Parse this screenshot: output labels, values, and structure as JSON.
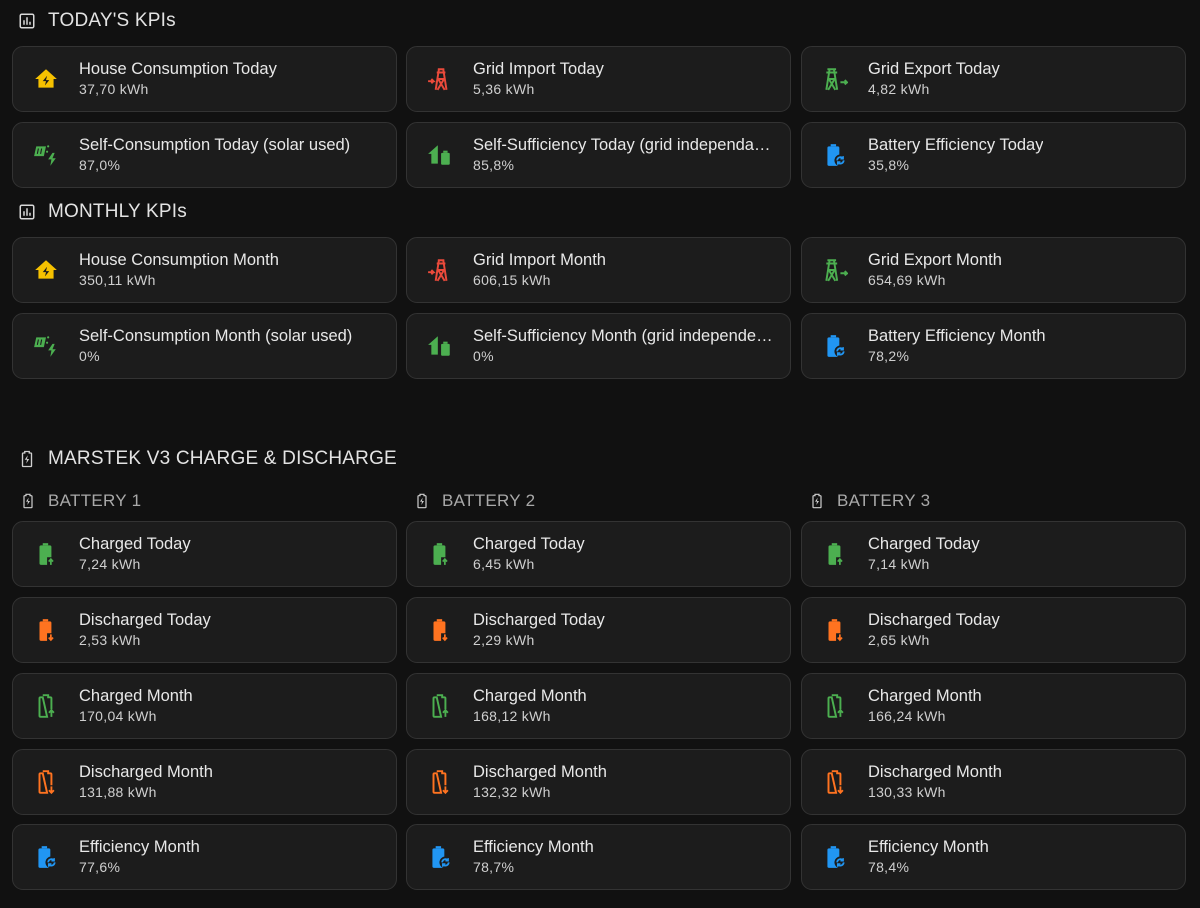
{
  "colors": {
    "yellow": "#f6c100",
    "red": "#ea4a3b",
    "green": "#4caf50",
    "orange": "#ff7320",
    "blue": "#2196f3"
  },
  "today": {
    "title": "TODAY'S KPIs",
    "cards": [
      {
        "name": "House Consumption Today",
        "value": "37,70 kWh",
        "icon": "home-lightning-icon"
      },
      {
        "name": "Grid Import Today",
        "value": "5,36 kWh",
        "icon": "transmission-tower-import-icon"
      },
      {
        "name": "Grid Export Today",
        "value": "4,82 kWh",
        "icon": "transmission-tower-export-icon"
      },
      {
        "name": "Self-Consumption Today (solar used)",
        "value": "87,0%",
        "icon": "solar-power-variant-icon"
      },
      {
        "name": "Self-Sufficiency Today (grid independa…",
        "value": "85,8%",
        "icon": "home-battery-icon"
      },
      {
        "name": "Battery Efficiency Today",
        "value": "35,8%",
        "icon": "battery-sync-icon"
      }
    ]
  },
  "month": {
    "title": "MONTHLY KPIs",
    "cards": [
      {
        "name": "House Consumption Month",
        "value": "350,11 kWh",
        "icon": "home-lightning-icon"
      },
      {
        "name": "Grid Import Month",
        "value": "606,15 kWh",
        "icon": "transmission-tower-import-icon"
      },
      {
        "name": "Grid Export Month",
        "value": "654,69 kWh",
        "icon": "transmission-tower-export-icon"
      },
      {
        "name": "Self-Consumption Month (solar used)",
        "value": "0%",
        "icon": "solar-power-variant-icon"
      },
      {
        "name": "Self-Sufficiency Month (grid independe…",
        "value": "0%",
        "icon": "home-battery-icon"
      },
      {
        "name": "Battery Efficiency Month",
        "value": "78,2%",
        "icon": "battery-sync-icon"
      }
    ]
  },
  "marstek": {
    "title": "MARSTEK V3 CHARGE & DISCHARGE",
    "batteries": [
      {
        "label": "BATTERY 1",
        "cards": [
          {
            "name": "Charged Today",
            "value": "7,24 kWh"
          },
          {
            "name": "Discharged Today",
            "value": "2,53 kWh"
          },
          {
            "name": "Charged Month",
            "value": "170,04 kWh"
          },
          {
            "name": "Discharged Month",
            "value": "131,88 kWh"
          },
          {
            "name": "Efficiency Month",
            "value": "77,6%"
          }
        ]
      },
      {
        "label": "BATTERY 2",
        "cards": [
          {
            "name": "Charged Today",
            "value": "6,45 kWh"
          },
          {
            "name": "Discharged Today",
            "value": "2,29 kWh"
          },
          {
            "name": "Charged Month",
            "value": "168,12 kWh"
          },
          {
            "name": "Discharged Month",
            "value": "132,32 kWh"
          },
          {
            "name": "Efficiency Month",
            "value": "78,7%"
          }
        ]
      },
      {
        "label": "BATTERY 3",
        "cards": [
          {
            "name": "Charged Today",
            "value": "7,14 kWh"
          },
          {
            "name": "Discharged Today",
            "value": "2,65 kWh"
          },
          {
            "name": "Charged Month",
            "value": "166,24 kWh"
          },
          {
            "name": "Discharged Month",
            "value": "130,33 kWh"
          },
          {
            "name": "Efficiency Month",
            "value": "78,4%"
          }
        ]
      }
    ]
  }
}
